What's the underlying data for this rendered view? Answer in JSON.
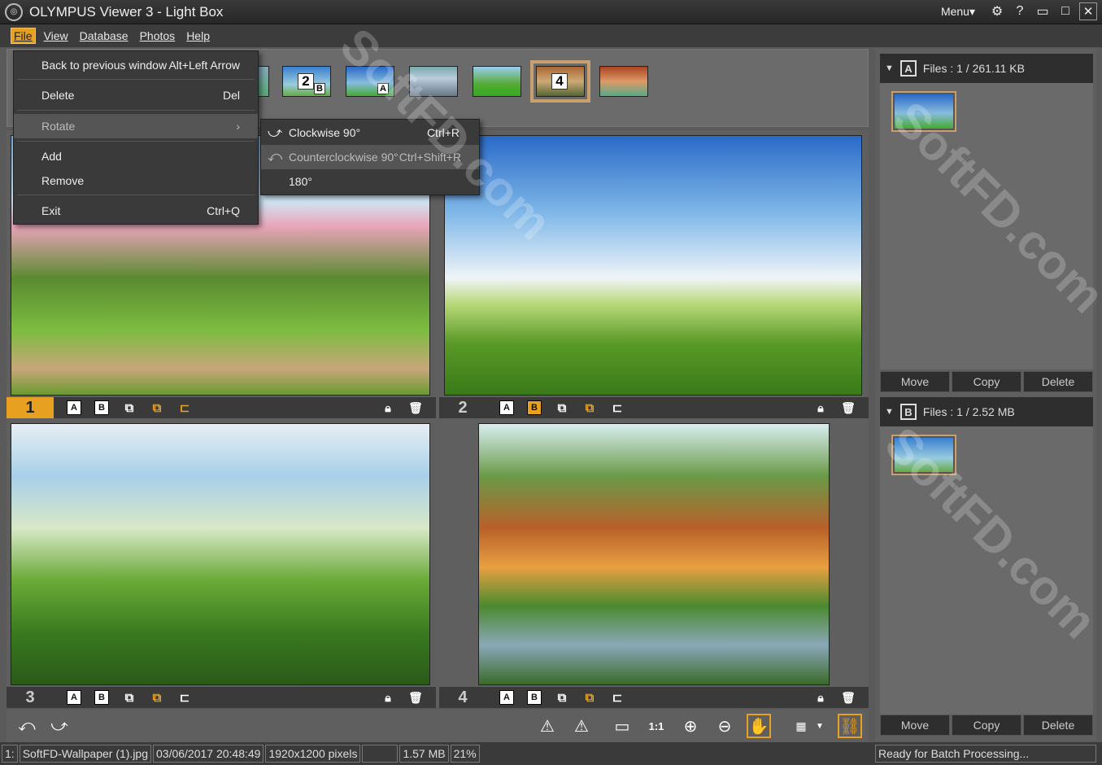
{
  "window": {
    "app_name": "OLYMPUS Viewer 3",
    "separator": " - ",
    "mode": "Light Box",
    "menu_label": "Menu▾"
  },
  "menubar": {
    "items": [
      {
        "label": "File",
        "active": true
      },
      {
        "label": "View"
      },
      {
        "label": "Database"
      },
      {
        "label": "Photos"
      },
      {
        "label": "Help"
      }
    ]
  },
  "file_menu": {
    "back": {
      "label": "Back to previous window",
      "shortcut": "Alt+Left Arrow"
    },
    "delete": {
      "label": "Delete",
      "shortcut": "Del"
    },
    "rotate": {
      "label": "Rotate"
    },
    "add": {
      "label": "Add"
    },
    "remove": {
      "label": "Remove"
    },
    "exit": {
      "label": "Exit",
      "shortcut": "Ctrl+Q"
    }
  },
  "rotate_submenu": {
    "clockwise": {
      "label": "Clockwise 90°",
      "shortcut": "Ctrl+R"
    },
    "counter": {
      "label": "Counterclockwise 90°",
      "shortcut": "Ctrl+Shift+R"
    },
    "r180": {
      "label": "180°"
    }
  },
  "filmstrip": {
    "thumbs": [
      {
        "badge": "2",
        "badge2": "B"
      },
      {
        "badge": "A"
      },
      {
        "badge": ""
      },
      {
        "badge": ""
      },
      {
        "badge": "4",
        "selected": true
      },
      {
        "badge": ""
      }
    ]
  },
  "cells": [
    {
      "number": "1",
      "selected": true
    },
    {
      "number": "2"
    },
    {
      "number": "3"
    },
    {
      "number": "4"
    }
  ],
  "labels": {
    "a": "A",
    "b": "B"
  },
  "panel_a": {
    "letter": "A",
    "files": "Files : 1 / 261.11 KB"
  },
  "panel_b": {
    "letter": "B",
    "files": "Files : 1 / 2.52 MB"
  },
  "panel_buttons": {
    "move": "Move",
    "copy": "Copy",
    "delete": "Delete"
  },
  "statusbar": {
    "index": "1:",
    "filename": "SoftFD-Wallpaper (1).jpg",
    "datetime": "03/06/2017 20:48:49",
    "dimensions": "1920x1200 pixels",
    "blank": "",
    "size": "1.57 MB",
    "zoom": "21%",
    "status": "Ready for Batch Processing..."
  },
  "watermark": "SoftFD.com"
}
